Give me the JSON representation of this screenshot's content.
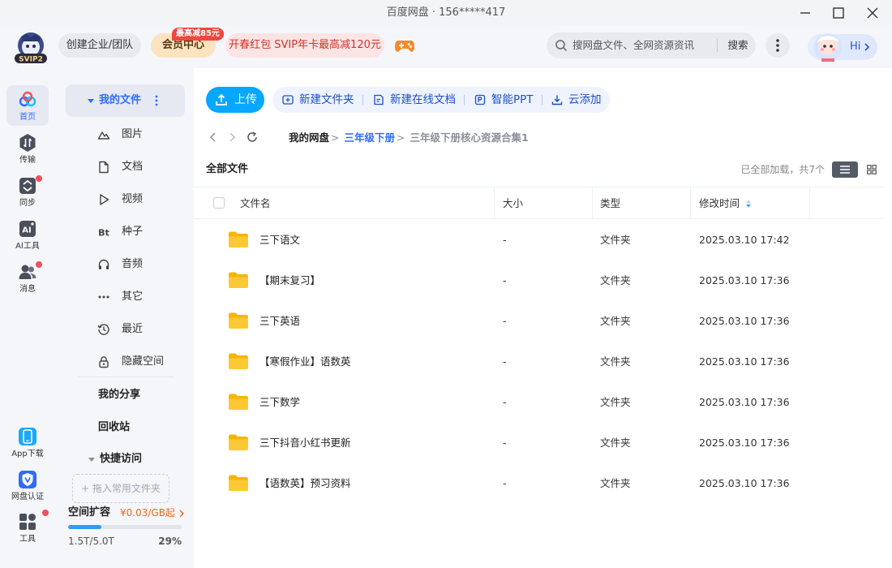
{
  "window": {
    "title": "百度网盘 · 156*****417"
  },
  "header": {
    "logo_text": "SVIP2",
    "enterprise_label": "创建企业/团队",
    "vip_label": "会员中心",
    "vip_badge": "最高减85元",
    "promo_label": "开春红包 SVIP年卡最高减120元",
    "search_placeholder": "搜网盘文件、全网资源资讯",
    "search_button": "搜索",
    "greeting": "Hi"
  },
  "rail": [
    {
      "label": "首页",
      "icon": "cloud-home-icon",
      "active": true
    },
    {
      "label": "传输",
      "icon": "transfer-icon",
      "badge": false
    },
    {
      "label": "同步",
      "icon": "sync-icon",
      "badge": true
    },
    {
      "label": "AI工具",
      "icon": "ai-tool-icon",
      "badge": false
    },
    {
      "label": "消息",
      "icon": "message-icon",
      "badge": true
    }
  ],
  "rail_bottom": [
    {
      "label": "App下载",
      "icon": "app-download-icon"
    },
    {
      "label": "网盘认证",
      "icon": "verify-icon"
    },
    {
      "label": "工具",
      "icon": "tools-icon",
      "badge": true
    }
  ],
  "tree": {
    "root": "我的文件",
    "items": [
      {
        "label": "图片",
        "icon": "image-icon"
      },
      {
        "label": "文档",
        "icon": "document-icon"
      },
      {
        "label": "视频",
        "icon": "video-icon"
      },
      {
        "label": "种子",
        "icon": "torrent-icon"
      },
      {
        "label": "音频",
        "icon": "audio-icon"
      },
      {
        "label": "其它",
        "icon": "other-icon"
      },
      {
        "label": "最近",
        "icon": "recent-icon"
      },
      {
        "label": "隐藏空间",
        "icon": "lock-icon"
      }
    ],
    "share": "我的分享",
    "recycle": "回收站",
    "quick": "快捷访问",
    "drop_hint": "+ 拖入常用文件夹"
  },
  "storage": {
    "title": "空间扩容",
    "price": "¥0.03/GB起",
    "used_text": "1.5T/5.0T",
    "percent_text": "29%",
    "fraction": 0.29
  },
  "toolbar": {
    "upload": "上传",
    "new_folder": "新建文件夹",
    "new_doc": "新建在线文档",
    "smart_ppt": "智能PPT",
    "cloud_add": "云添加"
  },
  "breadcrumb": {
    "root": "我的网盘",
    "level1": "三年级下册",
    "level2": "三年级下册核心资源合集1",
    "sep": ">"
  },
  "list": {
    "title": "全部文件",
    "loaded_text": "已全部加载，共7个",
    "columns": {
      "name": "文件名",
      "size": "大小",
      "type": "类型",
      "modified": "修改时间"
    },
    "rows": [
      {
        "name": "三下语文",
        "size": "-",
        "type": "文件夹",
        "modified": "2025.03.10 17:42"
      },
      {
        "name": "【期末复习】",
        "size": "-",
        "type": "文件夹",
        "modified": "2025.03.10 17:36"
      },
      {
        "name": "三下英语",
        "size": "-",
        "type": "文件夹",
        "modified": "2025.03.10 17:36"
      },
      {
        "name": "【寒假作业】语数英",
        "size": "-",
        "type": "文件夹",
        "modified": "2025.03.10 17:36"
      },
      {
        "name": "三下数学",
        "size": "-",
        "type": "文件夹",
        "modified": "2025.03.10 17:36"
      },
      {
        "name": "三下抖音小红书更新",
        "size": "-",
        "type": "文件夹",
        "modified": "2025.03.10 17:36"
      },
      {
        "name": "【语数英】预习资料",
        "size": "-",
        "type": "文件夹",
        "modified": "2025.03.10 17:36"
      }
    ]
  },
  "colors": {
    "accent": "#2f6bff",
    "upload": "#06a7ff",
    "folder": "#f9c22d",
    "badge": "#f24f5c",
    "promo_text": "#d2332a"
  }
}
